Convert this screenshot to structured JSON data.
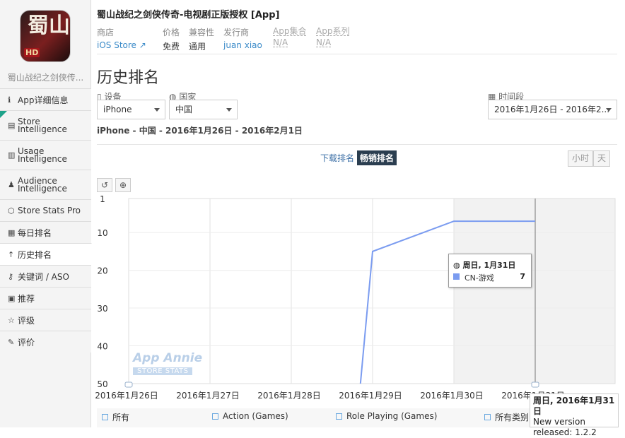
{
  "app": {
    "title": "蜀山战纪之剑侠传奇-电视剧正版授权 [App]",
    "icon_text": "蜀山",
    "icon_badge": "HD",
    "short_name": "蜀山战纪之剑侠传..."
  },
  "meta": [
    {
      "key": "商店",
      "value": "iOS Store"
    },
    {
      "key": "价格",
      "value": "免费"
    },
    {
      "key": "兼容性",
      "value": "通用"
    },
    {
      "key": "发行商",
      "value": "juan xiao"
    },
    {
      "key": "App集合",
      "value": "N/A"
    },
    {
      "key": "App系列",
      "value": "N/A"
    }
  ],
  "sidebar": {
    "items": [
      {
        "icon": "info-icon",
        "label": "App详细信息"
      },
      {
        "icon": "store-icon",
        "label1": "Store",
        "label2": "Intelligence"
      },
      {
        "icon": "usage-icon",
        "label1": "Usage",
        "label2": "Intelligence"
      },
      {
        "icon": "person-icon",
        "label1": "Audience",
        "label2": "Intelligence"
      },
      {
        "icon": "stats-icon",
        "label": "Store Stats Pro"
      },
      {
        "icon": "calendar-icon",
        "label": "每日排名"
      },
      {
        "icon": "arrow-up-icon",
        "label": "历史排名"
      },
      {
        "icon": "key-icon",
        "label": "关键词 / ASO"
      },
      {
        "icon": "recommend-icon",
        "label": "推荐"
      },
      {
        "icon": "star-icon",
        "label": "评级"
      },
      {
        "icon": "comment-icon",
        "label": "评价"
      }
    ]
  },
  "page_title": "历史排名",
  "filters": {
    "device_label": "设备",
    "device_value": "iPhone",
    "country_label": "国家",
    "country_value": "中国",
    "period_label": "时间段",
    "period_value": "2016年1月26日 - 2016年2..."
  },
  "subtitle": "iPhone - 中国 - 2016年1月26日 - 2016年2月1日",
  "tabs": {
    "download": "下载排名",
    "grossing": "畅销排名"
  },
  "granularity": {
    "hour": "小时",
    "day": "天"
  },
  "tools": {
    "reset": "↺",
    "zoom": "⊕"
  },
  "watermark": {
    "line1": "App Annie",
    "line2": "STORE STATS"
  },
  "chart_data": {
    "type": "line",
    "y_reversed": true,
    "ylim": [
      1,
      50
    ],
    "y_ticks": [
      "1",
      "10",
      "20",
      "30",
      "40",
      "50"
    ],
    "x_ticks": [
      "2016年1月26日",
      "2016年1月27日",
      "2016年1月28日",
      "2016年1月29日",
      "2016年1月30日",
      "2016年1月31日"
    ],
    "series": [
      {
        "name": "CN-游戏",
        "color": "#7b9cf0",
        "points": [
          [
            2.85,
            51
          ],
          [
            3.0,
            15
          ],
          [
            4.0,
            7
          ],
          [
            5.0,
            7
          ]
        ]
      }
    ]
  },
  "tooltip": {
    "date": "周日, 1月31日",
    "series": "CN-游戏",
    "value": "7"
  },
  "version_tip": {
    "date": "周日, 2016年1月31日",
    "line1": "New version",
    "line2": "released: 1.2.2"
  },
  "legend": [
    "所有",
    "Action (Games)",
    "Role Playing (Games)",
    "所有类别"
  ]
}
